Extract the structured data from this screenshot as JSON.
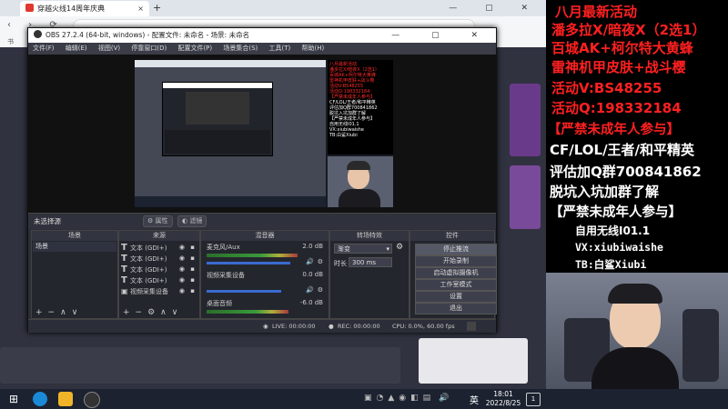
{
  "browser": {
    "tab_title": "穿越火线14周年庆典",
    "tab_close": "×",
    "new_tab": "+",
    "window_controls": "— ▢ ✕",
    "bookmark_label": "书"
  },
  "obs": {
    "title": "OBS 27.2.4 (64-bit, windows) - 配置文件: 未命名 - 场景: 未命名",
    "window_controls": "— ▢ ✕",
    "menu": [
      "文件(F)",
      "编辑(E)",
      "视图(V)",
      "停靠窗口(D)",
      "配置文件(P)",
      "场景集合(S)",
      "工具(T)",
      "帮助(H)"
    ],
    "no_source": "未选择源",
    "properties_label": "属性",
    "filters_label": "滤镜",
    "docks": {
      "scenes": "场景",
      "sources": "来源",
      "mixer": "混音器",
      "transitions": "转场特效",
      "controls": "控件"
    },
    "scene_item": "场景",
    "sources": [
      {
        "label": "文本 (GDI+)",
        "type": "text"
      },
      {
        "label": "文本 (GDI+)",
        "type": "text"
      },
      {
        "label": "文本 (GDI+)",
        "type": "text"
      },
      {
        "label": "文本 (GDI+)",
        "type": "text"
      },
      {
        "label": "视频采集设备",
        "type": "video"
      }
    ],
    "mixer": [
      {
        "name": "麦克风/Aux",
        "db": "2.0 dB",
        "level": 0.78,
        "volume": 0.9
      },
      {
        "name": "视频采集设备",
        "db": "0.0 dB",
        "level": 0.0,
        "volume": 0.8
      },
      {
        "name": "桌面音频",
        "db": "-6.0 dB",
        "level": 0.7,
        "volume": 0.6
      }
    ],
    "transition": {
      "type": "渐变",
      "duration_label": "时长",
      "duration": "300 ms"
    },
    "controls": [
      "停止推流",
      "开始录制",
      "启动虚拟摄像机",
      "工作室模式",
      "设置",
      "退出"
    ],
    "status": {
      "live": "LIVE: 00:00:00",
      "rec": "REC: 00:00:00",
      "cpu": "CPU: 0.0%, 60.00 fps"
    }
  },
  "overlay": {
    "lines": [
      {
        "text": "八月最新活动",
        "color": "#ff2020"
      },
      {
        "text": "潘多拉X/暗夜X（2选1）",
        "color": "#ff2020"
      },
      {
        "text": "百城AK+柯尔特大黄蜂",
        "color": "#ff2020"
      },
      {
        "text": "雷神机甲皮肤+战斗樱",
        "color": "#ff2020"
      },
      {
        "text": "活动V:BS48255",
        "color": "#ff2020"
      },
      {
        "text": "活动Q:198332184",
        "color": "#ff2020"
      },
      {
        "text": "【严禁未成年人参与】",
        "color": "#ff2020"
      },
      {
        "text": "CF/LOL/王者/和平精英",
        "color": "#ffffff"
      },
      {
        "text": "评估加Q群700841862",
        "color": "#ffffff"
      },
      {
        "text": "脱坑入坑加群了解",
        "color": "#ffffff"
      },
      {
        "text": "【严禁未成年人参与】",
        "color": "#ffffff"
      },
      {
        "text": "自用无线I01.1",
        "color": "#ffffff"
      },
      {
        "text": "VX:xiubiwaishe",
        "color": "#ffffff"
      },
      {
        "text": "TB:白鲨Xiubi",
        "color": "#ffffff"
      }
    ]
  },
  "taskbar": {
    "time": "18:01",
    "date": "2022/8/25",
    "ime": "英",
    "notification_count": "1"
  },
  "colors": {
    "accent_red": "#ff2020",
    "taskbar": "#1c2230",
    "obs_bg": "#2b2e38"
  }
}
